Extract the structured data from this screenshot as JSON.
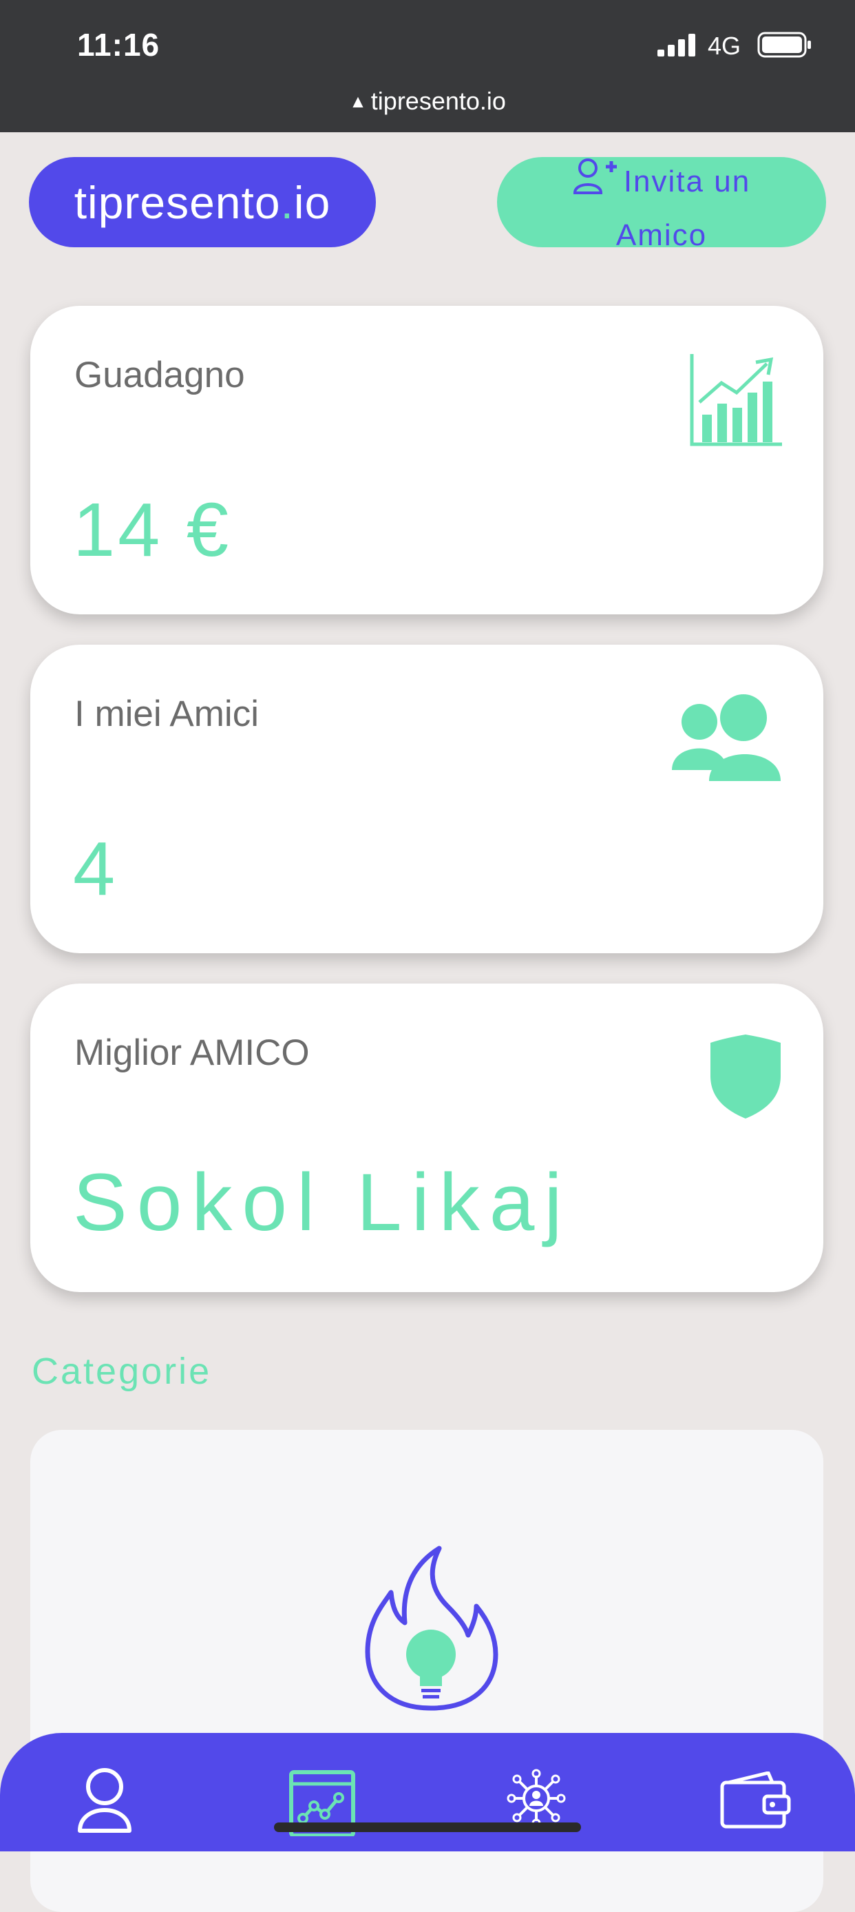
{
  "status_bar": {
    "time": "11:16",
    "network": "4G"
  },
  "browser": {
    "url": "tipresento.io"
  },
  "header": {
    "logo_main": "tipresento",
    "logo_dot": ".",
    "logo_suffix": "io",
    "invite_line1": "Invita un",
    "invite_line2": "Amico"
  },
  "stats": {
    "earnings": {
      "label": "Guadagno",
      "value": "14 €"
    },
    "friends": {
      "label": "I miei Amici",
      "value": "4"
    },
    "best_friend": {
      "label": "Miglior AMICO",
      "value": "Sokol Likaj"
    }
  },
  "categories": {
    "title": "Categorie"
  },
  "colors": {
    "primary": "#5249ea",
    "accent": "#6be3b4",
    "background": "#ebe7e6"
  },
  "nav": {
    "items": [
      {
        "icon": "user-icon"
      },
      {
        "icon": "chart-screen-icon",
        "active": true
      },
      {
        "icon": "network-person-icon"
      },
      {
        "icon": "wallet-icon"
      }
    ]
  }
}
